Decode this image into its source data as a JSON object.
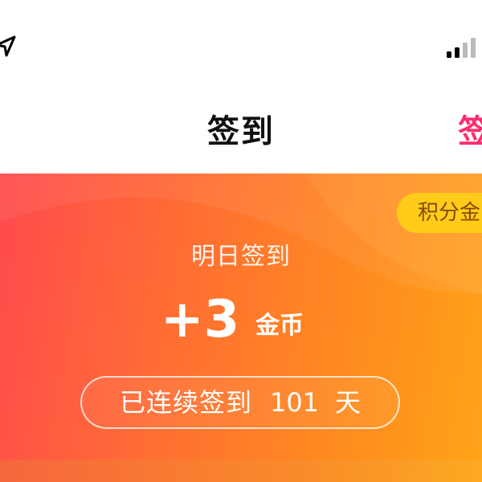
{
  "status_bar": {
    "location_icon": "location-arrow-icon",
    "signal_icon": "cellular-signal-icon"
  },
  "nav": {
    "title": "签到",
    "right_link": "签"
  },
  "banner": {
    "points_badge": "积分金",
    "tomorrow_label": "明日签到",
    "reward_amount": "+3",
    "reward_unit": "金币",
    "streak_prefix": "已连续签到",
    "streak_count": "101",
    "streak_suffix": "天"
  },
  "colors": {
    "accent": "#ff2d6f",
    "banner_start": "#ff4a4e",
    "banner_end": "#ffa418",
    "badge": "#ffcc1a"
  }
}
